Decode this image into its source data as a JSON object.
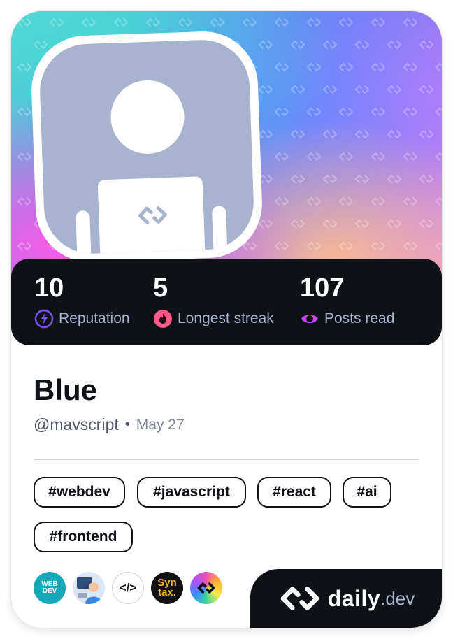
{
  "profile": {
    "name": "Blue",
    "handle": "@mavscript",
    "separator": "•",
    "joined": "May 27"
  },
  "stats": [
    {
      "value": "10",
      "label": "Reputation",
      "icon": "lightning-icon",
      "color": "#7d52ff"
    },
    {
      "value": "5",
      "label": "Longest streak",
      "icon": "flame-icon",
      "color": "#ff5a8a"
    },
    {
      "value": "107",
      "label": "Posts read",
      "icon": "eye-icon",
      "color": "#c642ff"
    }
  ],
  "tags": [
    "#webdev",
    "#javascript",
    "#react",
    "#ai",
    "#frontend"
  ],
  "sources": [
    {
      "name": "web-dev-source",
      "text": "WEB DEV",
      "bg": "#15a8b8"
    },
    {
      "name": "developer-illustration-source",
      "text": "",
      "bg": "#dbe7f5"
    },
    {
      "name": "code-tag-source",
      "text": "</>",
      "bg": "#ffffff"
    },
    {
      "name": "syntax-source",
      "text": "Syn tax.",
      "bg": "#111111"
    },
    {
      "name": "daily-dev-source",
      "text": "",
      "bg": "#f04fb3"
    }
  ],
  "brand": {
    "word": "daily",
    "tld": ".dev"
  },
  "colors": {
    "dark": "#0e1217",
    "muted": "#a8b3cf"
  }
}
